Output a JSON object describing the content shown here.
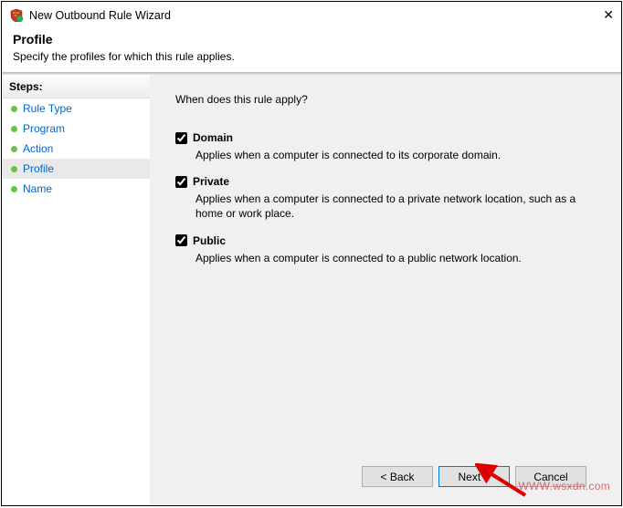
{
  "window": {
    "title": "New Outbound Rule Wizard"
  },
  "header": {
    "title": "Profile",
    "subtitle": "Specify the profiles for which this rule applies."
  },
  "sidebar": {
    "heading": "Steps:",
    "items": [
      {
        "label": "Rule Type",
        "active": false
      },
      {
        "label": "Program",
        "active": false
      },
      {
        "label": "Action",
        "active": false
      },
      {
        "label": "Profile",
        "active": true
      },
      {
        "label": "Name",
        "active": false
      }
    ]
  },
  "content": {
    "question": "When does this rule apply?",
    "profiles": [
      {
        "label": "Domain",
        "checked": true,
        "desc": "Applies when a computer is connected to its corporate domain."
      },
      {
        "label": "Private",
        "checked": true,
        "desc": "Applies when a computer is connected to a private network location, such as a home or work place."
      },
      {
        "label": "Public",
        "checked": true,
        "desc": "Applies when a computer is connected to a public network location."
      }
    ]
  },
  "footer": {
    "back": "< Back",
    "next": "Next >",
    "cancel": "Cancel"
  },
  "watermark": "WWW.wsxdn.com"
}
